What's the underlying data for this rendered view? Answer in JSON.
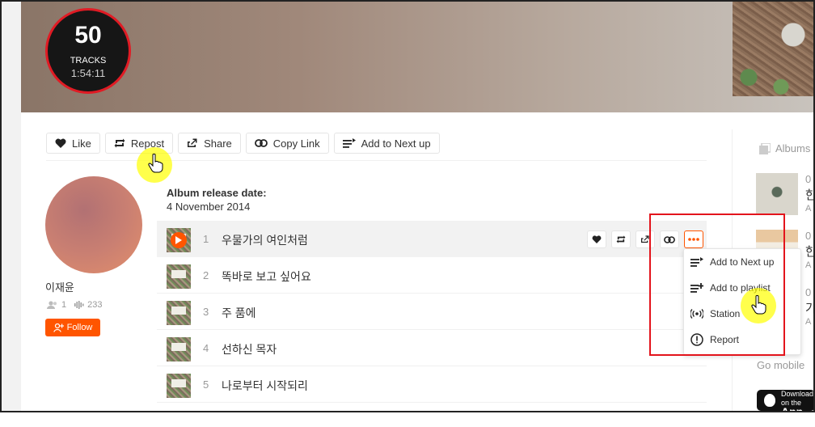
{
  "hero": {
    "track_count": "50",
    "tracks_label": "TRACKS",
    "duration": "1:54:11"
  },
  "actions": {
    "like": "Like",
    "repost": "Repost",
    "share": "Share",
    "copy_link": "Copy Link",
    "add_next": "Add to Next up"
  },
  "artist": {
    "name": "이재윤",
    "followers": "1",
    "tracks": "233",
    "follow_label": "Follow"
  },
  "album": {
    "release_label": "Album release date:",
    "release_date": "4 November 2014"
  },
  "tracks": [
    {
      "num": "1",
      "title": "우물가의 여인처럼"
    },
    {
      "num": "2",
      "title": "똑바로 보고 싶어요"
    },
    {
      "num": "3",
      "title": "주 품에"
    },
    {
      "num": "4",
      "title": "선하신 목자"
    },
    {
      "num": "5",
      "title": "나로부터 시작되리"
    }
  ],
  "menu": {
    "add_next": "Add to Next up",
    "add_playlist": "Add to playlist",
    "station": "Station",
    "report": "Report"
  },
  "sidebar": {
    "albums_label": "Albums",
    "item1": {
      "line1": "0",
      "line2": "한",
      "line3": "A"
    },
    "item2": {
      "line1": "0",
      "line2": "한",
      "line3": "A"
    },
    "item3": {
      "line1": "0",
      "line2": "가",
      "line3": "A"
    },
    "go_mobile": "Go mobile",
    "app_small": "Download on the",
    "app_big": "App Store"
  },
  "colors": {
    "accent": "#ff5500",
    "highlight_box": "#e3141c"
  }
}
